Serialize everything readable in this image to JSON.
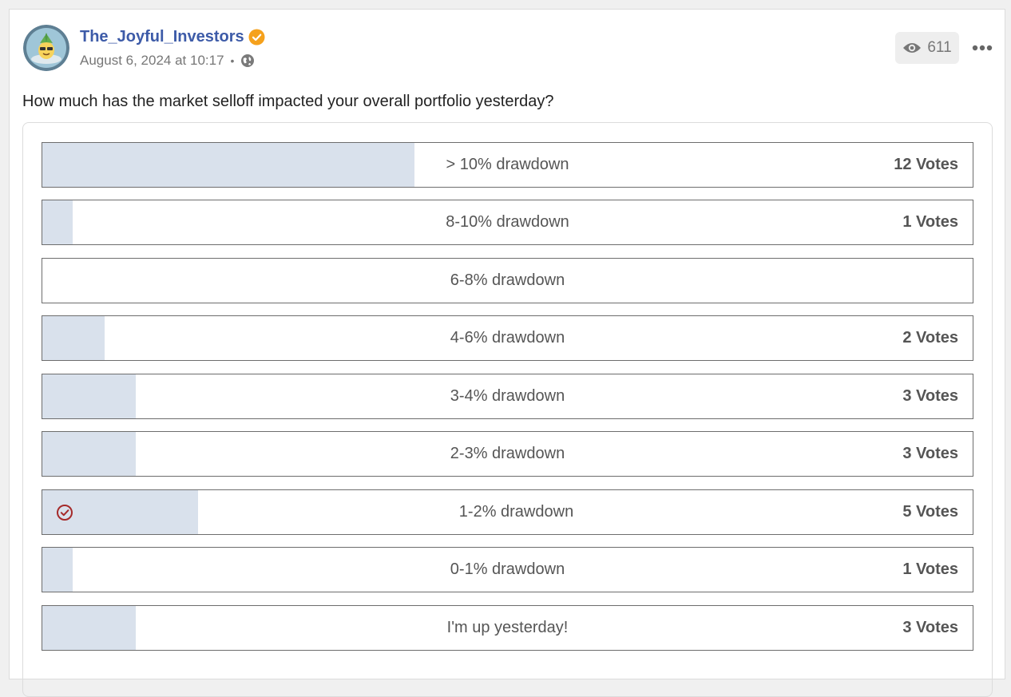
{
  "post": {
    "author": "The_Joyful_Investors",
    "timestamp": "August 6, 2024 at 10:17",
    "separator": "•",
    "views": "611",
    "question": "How much has the market selloff impacted your overall portfolio yesterday?"
  },
  "colors": {
    "author": "#3d5ba8",
    "verified_badge": "#f5a11c",
    "bar_fill": "#d9e1ec",
    "check": "#a52a2a"
  },
  "icons": {
    "verified": "verified-check-icon",
    "privacy": "globe-icon",
    "views": "eye-icon",
    "more": "more-options-icon",
    "selected": "check-circle-icon"
  },
  "poll": {
    "options": [
      {
        "label": "> 10% drawdown",
        "votes": "12 Votes",
        "fill_fraction": 0.4,
        "selected": false
      },
      {
        "label": "8-10% drawdown",
        "votes": "1 Votes",
        "fill_fraction": 0.033,
        "selected": false
      },
      {
        "label": "6-8% drawdown",
        "votes": "",
        "fill_fraction": 0,
        "selected": false
      },
      {
        "label": "4-6% drawdown",
        "votes": "2 Votes",
        "fill_fraction": 0.067,
        "selected": false
      },
      {
        "label": "3-4% drawdown",
        "votes": "3 Votes",
        "fill_fraction": 0.1,
        "selected": false
      },
      {
        "label": "2-3% drawdown",
        "votes": "3 Votes",
        "fill_fraction": 0.1,
        "selected": false
      },
      {
        "label": "1-2% drawdown",
        "votes": "5 Votes",
        "fill_fraction": 0.167,
        "selected": true
      },
      {
        "label": "0-1% drawdown",
        "votes": "1 Votes",
        "fill_fraction": 0.033,
        "selected": false
      },
      {
        "label": "I'm up yesterday!",
        "votes": "3 Votes",
        "fill_fraction": 0.1,
        "selected": false
      }
    ]
  }
}
